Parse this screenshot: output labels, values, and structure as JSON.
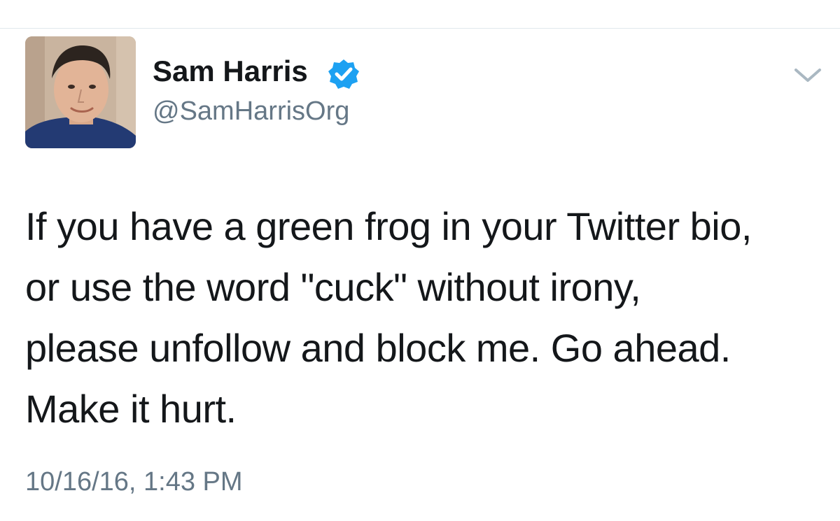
{
  "tweet": {
    "author": {
      "name": "Sam Harris",
      "handle": "@SamHarrisOrg",
      "verified": true
    },
    "text_lines": [
      "If you have a green frog in your Twitter bio,",
      "or use the word \"cuck\" without irony,",
      "please unfollow and block me. Go ahead.",
      "Make it hurt."
    ],
    "timestamp": "10/16/16, 1:43 PM"
  },
  "icons": {
    "verified": "verified-badge-icon",
    "menu": "chevron-down-icon"
  },
  "colors": {
    "verified_blue": "#1da1f2",
    "text": "#14171a",
    "secondary_text": "#657786",
    "divider": "#e1e8ed",
    "chevron": "#aab8c2"
  }
}
